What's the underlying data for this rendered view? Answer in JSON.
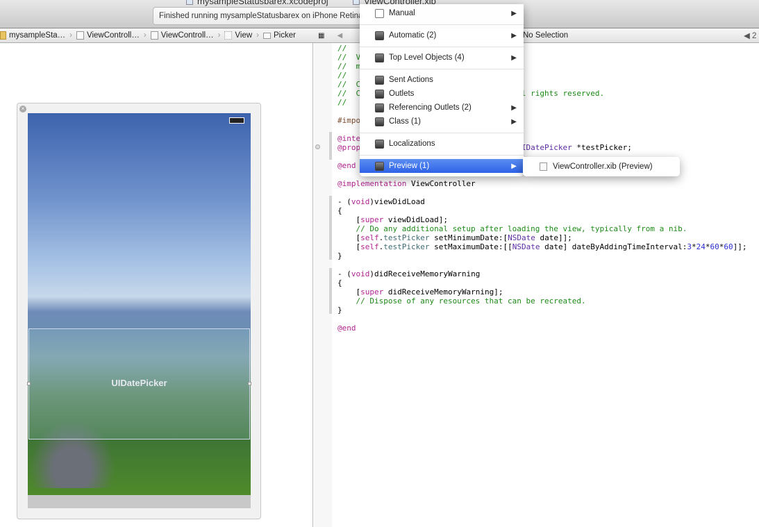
{
  "window": {
    "project_title": "mysampleStatusbarex.xcodeproj",
    "file_title": "ViewController.xib",
    "status": "Finished running mysampleStatusbarex on iPhone Retina"
  },
  "breadcrumb": [
    "mysampleSta…",
    "ViewControll…",
    "ViewControll…",
    "View",
    "Picker"
  ],
  "editor_jump": {
    "selection": "No Selection",
    "counter": "2"
  },
  "canvas": {
    "picker_label": "UIDatePicker"
  },
  "menu": {
    "items": [
      {
        "label": "Manual",
        "submenu": true
      },
      {
        "label": "Automatic (2)",
        "submenu": true
      },
      {
        "label": "Top Level Objects (4)",
        "submenu": true
      },
      {
        "label": "Sent Actions",
        "submenu": false
      },
      {
        "label": "Outlets",
        "submenu": false
      },
      {
        "label": "Referencing Outlets (2)",
        "submenu": true
      },
      {
        "label": "Class (1)",
        "submenu": true
      },
      {
        "label": "Localizations",
        "submenu": false
      },
      {
        "label": "Preview (1)",
        "submenu": true,
        "highlighted": true
      }
    ],
    "submenu_item": "ViewController.xib (Preview)"
  },
  "code": [
    [
      [
        "//",
        "cm"
      ]
    ],
    [
      [
        "//  V",
        "cm"
      ]
    ],
    [
      [
        "//  m",
        "cm"
      ]
    ],
    [
      [
        "//",
        "cm"
      ]
    ],
    [
      [
        "//  C",
        "cm"
      ]
    ],
    [
      [
        "//  C                                   ",
        "cm"
      ],
      [
        "l rights reserved.",
        "cm"
      ]
    ],
    [
      [
        "//",
        "cm"
      ]
    ],
    [],
    [
      [
        "#impo",
        "pp"
      ]
    ],
    [],
    [
      [
        "@inte",
        "kw"
      ]
    ],
    [
      [
        "@prop",
        "kw"
      ],
      [
        "                                   IDatePicker ",
        "cls"
      ],
      [
        "*testPicker;",
        ""
      ]
    ],
    [],
    [
      [
        "@end",
        "kw"
      ]
    ],
    [],
    [
      [
        "@implementation",
        "kw"
      ],
      [
        " ViewController",
        ""
      ]
    ],
    [],
    [
      [
        "- (",
        ""
      ],
      [
        "void",
        "kw"
      ],
      [
        ")viewDidLoad",
        ""
      ]
    ],
    [
      [
        "{",
        ""
      ]
    ],
    [
      [
        "    [",
        ""
      ],
      [
        "super",
        "kw"
      ],
      [
        " viewDidLoad];",
        ""
      ]
    ],
    [
      [
        "    // Do any additional setup after loading the view, typically from a nib.",
        "cm"
      ]
    ],
    [
      [
        "    [",
        ""
      ],
      [
        "self",
        "kw"
      ],
      [
        ".",
        ""
      ],
      [
        "testPicker",
        "fn"
      ],
      [
        " setMinimumDate:[",
        ""
      ],
      [
        "NSDate",
        "cls"
      ],
      [
        " date]];",
        ""
      ]
    ],
    [
      [
        "    [",
        ""
      ],
      [
        "self",
        "kw"
      ],
      [
        ".",
        ""
      ],
      [
        "testPicker",
        "fn"
      ],
      [
        " setMaximumDate:[[",
        ""
      ],
      [
        "NSDate",
        "cls"
      ],
      [
        " date] dateByAddingTimeInterval:",
        ""
      ],
      [
        "3",
        "num"
      ],
      [
        "*",
        ""
      ],
      [
        "24",
        "num"
      ],
      [
        "*",
        ""
      ],
      [
        "60",
        "num"
      ],
      [
        "*",
        ""
      ],
      [
        "60",
        "num"
      ],
      [
        "]];",
        ""
      ]
    ],
    [
      [
        "}",
        ""
      ]
    ],
    [],
    [
      [
        "- (",
        ""
      ],
      [
        "void",
        "kw"
      ],
      [
        ")didReceiveMemoryWarning",
        ""
      ]
    ],
    [
      [
        "{",
        ""
      ]
    ],
    [
      [
        "    [",
        ""
      ],
      [
        "super",
        "kw"
      ],
      [
        " didReceiveMemoryWarning];",
        ""
      ]
    ],
    [
      [
        "    // Dispose of any resources that can be recreated.",
        "cm"
      ]
    ],
    [
      [
        "}",
        ""
      ]
    ],
    [],
    [
      [
        "@end",
        "kw"
      ]
    ]
  ]
}
